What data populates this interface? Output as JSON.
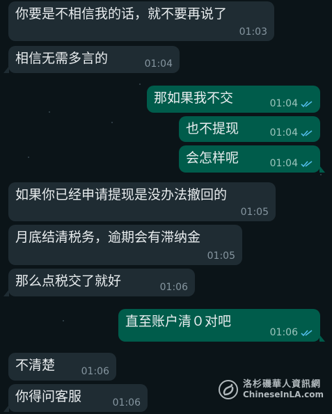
{
  "messages": [
    {
      "side": "in",
      "text": "你要是不相信我的话，就不要再说了",
      "time": "01:03"
    },
    {
      "side": "in",
      "text": "相信无需多言的",
      "time": "01:04"
    },
    {
      "side": "out",
      "text": "那如果我不交",
      "time": "01:04",
      "status": "read-double-check-icon"
    },
    {
      "side": "out",
      "text": "也不提现",
      "time": "01:04",
      "status": "read-double-check-icon"
    },
    {
      "side": "out",
      "text": "会怎样呢",
      "time": "01:04",
      "status": "read-double-check-icon"
    },
    {
      "side": "in",
      "text": "如果你已经申请提现是没办法撤回的",
      "time": "01:05"
    },
    {
      "side": "in",
      "text": "月底结清税务，逾期会有滞纳金",
      "time": "01:05"
    },
    {
      "side": "in",
      "text": "那么点税交了就好",
      "time": "01:06"
    },
    {
      "side": "out",
      "text": "直至账户清０对吧",
      "time": "01:06",
      "status": "read-double-check-icon"
    },
    {
      "side": "in",
      "text": "不清楚",
      "time": "01:06"
    },
    {
      "side": "in",
      "text": "你得问客服",
      "time": "01:06"
    }
  ],
  "colors": {
    "background": "#0b1418",
    "incoming_bubble": "#1f2c33",
    "outgoing_bubble": "#005c4b",
    "read_tick": "#53bdeb"
  },
  "watermark": {
    "chinese": "洛杉磯華人資訊網",
    "english": "ChineseInLA.com"
  }
}
